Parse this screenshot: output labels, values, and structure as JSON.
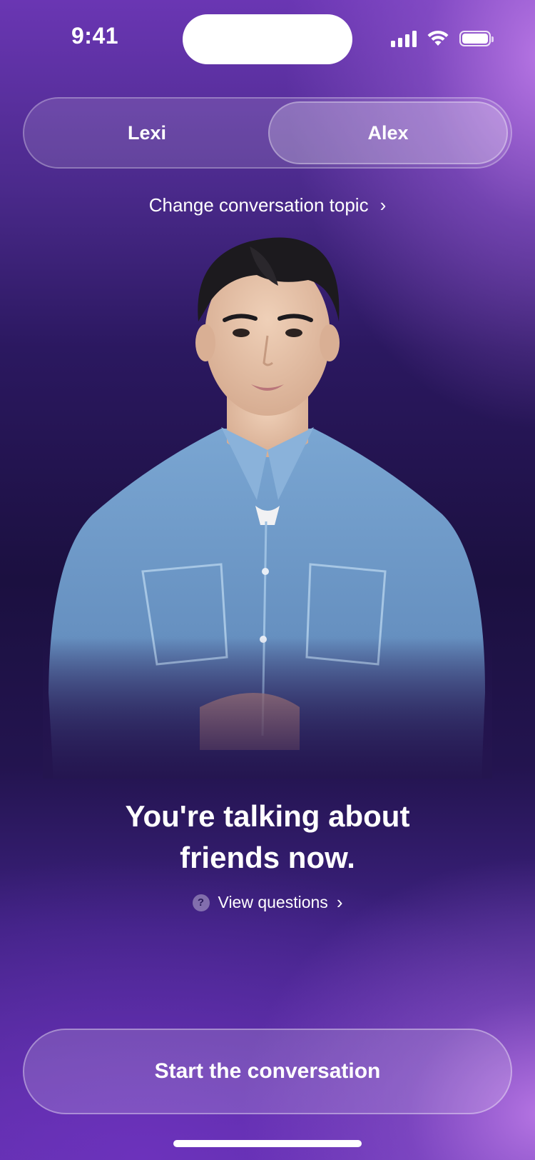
{
  "status_bar": {
    "time": "9:41",
    "icons": [
      "signal-icon",
      "wifi-icon",
      "battery-icon"
    ]
  },
  "tutor_selector": {
    "options": [
      {
        "label": "Lexi",
        "selected": false
      },
      {
        "label": "Alex",
        "selected": true
      }
    ]
  },
  "topic": {
    "change_label": "Change conversation topic"
  },
  "avatar": {
    "name": "Alex"
  },
  "headline": {
    "line1": "You're talking about",
    "line2": "friends now."
  },
  "questions": {
    "label": "View questions",
    "help_glyph": "?"
  },
  "cta": {
    "label": "Start the conversation"
  },
  "colors": {
    "background_top": "#6a36b3",
    "background_mid": "#1b1040",
    "accent_glow": "#ba78e6",
    "text": "#ffffff",
    "shirt": "#6f9cc8"
  }
}
